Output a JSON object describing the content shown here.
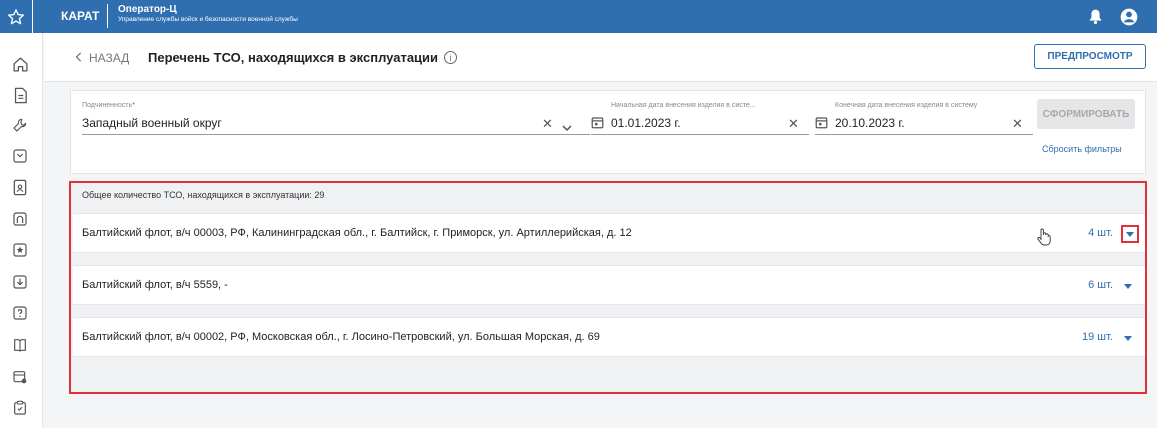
{
  "topbar": {
    "app_name": "КАРАТ",
    "role": "Оператор-Ц",
    "org": "Управление службы войск и безопасности военной службы"
  },
  "header": {
    "back_label": "НАЗАД",
    "title": "Перечень ТСО, находящихся в эксплуатации",
    "preview_label": "ПРЕДПРОСМОТР"
  },
  "filters": {
    "subordination": {
      "label": "Подчиненность",
      "value": "Западный военный округ"
    },
    "start_date": {
      "label": "Начальная дата внесения изделия в систе...",
      "value": "01.01.2023 г."
    },
    "end_date": {
      "label": "Конечная дата внесения изделия в систему",
      "value": "20.10.2023 г."
    },
    "form_label": "СФОРМИРОВАТЬ",
    "reset_label": "Сбросить фильтры"
  },
  "list": {
    "total": "Общее количество ТСО, находящихся в эксплуатации: 29",
    "rows": [
      {
        "address": "Балтийский флот, в/ч 00003, РФ, Калининградская обл., г. Балтийск, г. Приморск, ул. Артиллерийская, д. 12",
        "count": "4 шт."
      },
      {
        "address": "Балтийский флот, в/ч 5559, -",
        "count": "6 шт."
      },
      {
        "address": "Балтийский флот, в/ч 00002, РФ, Московская обл., г. Лосино-Петровский, ул. Большая Морская, д. 69",
        "count": "19 шт."
      }
    ]
  },
  "colors": {
    "primary": "#2f6fb0",
    "highlight": "#e0303a"
  }
}
